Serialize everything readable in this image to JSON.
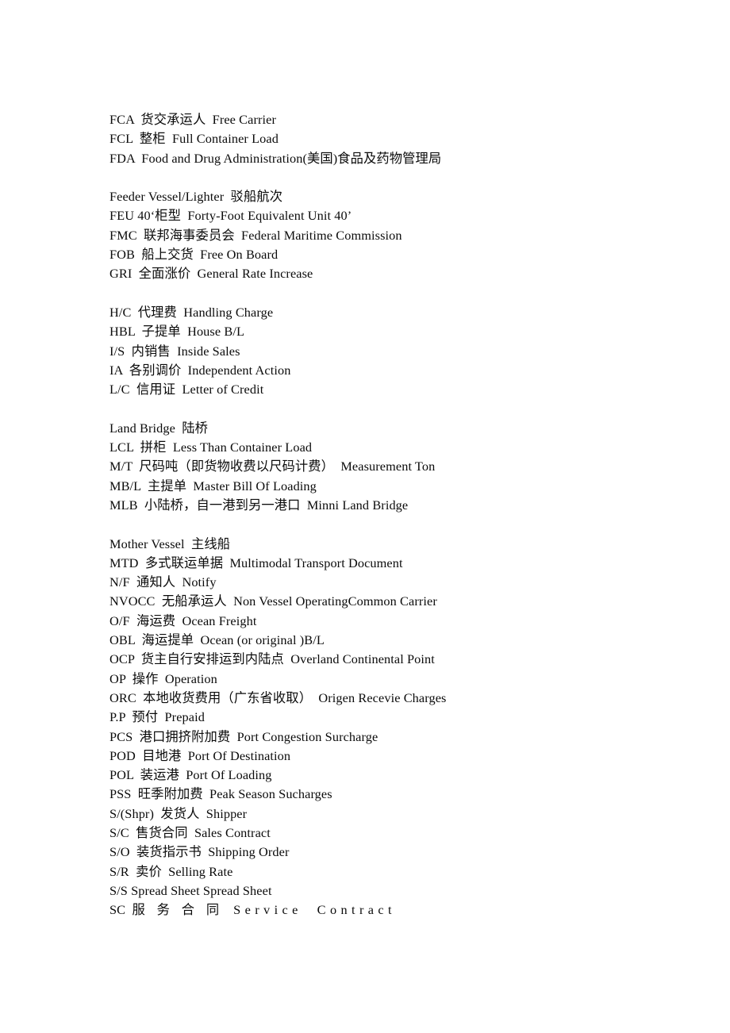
{
  "document": {
    "type": "glossary",
    "subject": "shipping-and-freight-abbreviations",
    "background_color": "#ffffff",
    "text_color": "#000000"
  },
  "glossary": {
    "groups": [
      {
        "id": "group-f-1",
        "entries": [
          "FCA  货交承运人  Free Carrier",
          "FCL  整柜  Full Container Load",
          "FDA  Food and Drug Administration(美国)食品及药物管理局"
        ]
      },
      {
        "id": "group-f-2",
        "entries": [
          "Feeder Vessel/Lighter  驳船航次",
          "FEU 40‘柜型  Forty-Foot Equivalent Unit 40’",
          "FMC  联邦海事委员会  Federal Maritime Commission",
          "FOB  船上交货  Free On Board",
          "GRI  全面涨价  General Rate Increase"
        ]
      },
      {
        "id": "group-h-l",
        "entries": [
          "H/C  代理费  Handling Charge",
          "HBL  子提单  House B/L",
          "I/S  内销售  Inside Sales",
          "IA  各别调价  Independent Action",
          "L/C  信用证  Letter of Credit"
        ]
      },
      {
        "id": "group-land-m",
        "entries": [
          "Land Bridge  陆桥",
          "LCL  拼柜  Less Than Container Load",
          "M/T  尺码吨（即货物收费以尺码计费）  Measurement Ton",
          "MB/L  主提单  Master Bill Of Loading",
          "MLB  小陆桥，自一港到另一港口  Minni Land Bridge"
        ]
      },
      {
        "id": "group-mother-sc",
        "entries": [
          "Mother Vessel  主线船",
          "MTD  多式联运单据  Multimodal Transport Document",
          "N/F  通知人  Notify",
          "NVOCC  无船承运人  Non Vessel OperatingCommon Carrier",
          "O/F  海运费  Ocean Freight",
          "OBL  海运提单  Ocean (or original )B/L",
          "OCP  货主自行安排运到内陆点  Overland Continental Point",
          "OP  操作  Operation",
          "ORC  本地收货费用（广东省收取）  Origen Recevie Charges",
          "P.P  预付  Prepaid",
          "PCS  港口拥挤附加费  Port Congestion Surcharge",
          "POD  目地港  Port Of Destination",
          "POL  装运港  Port Of Loading",
          "PSS  旺季附加费  Peak Season Sucharges",
          "S/(Shpr)  发货人  Shipper",
          "S/C  售货合同  Sales Contract",
          "S/O  装货指示书  Shipping Order",
          "S/R  卖价  Selling Rate",
          "S/S Spread Sheet Spread Sheet"
        ],
        "wide_entry": {
          "prefix": "SC  ",
          "spaced_chinese": "服 务 合 同",
          "separator": "   ",
          "spaced_english": "Service  Contract"
        }
      }
    ]
  }
}
